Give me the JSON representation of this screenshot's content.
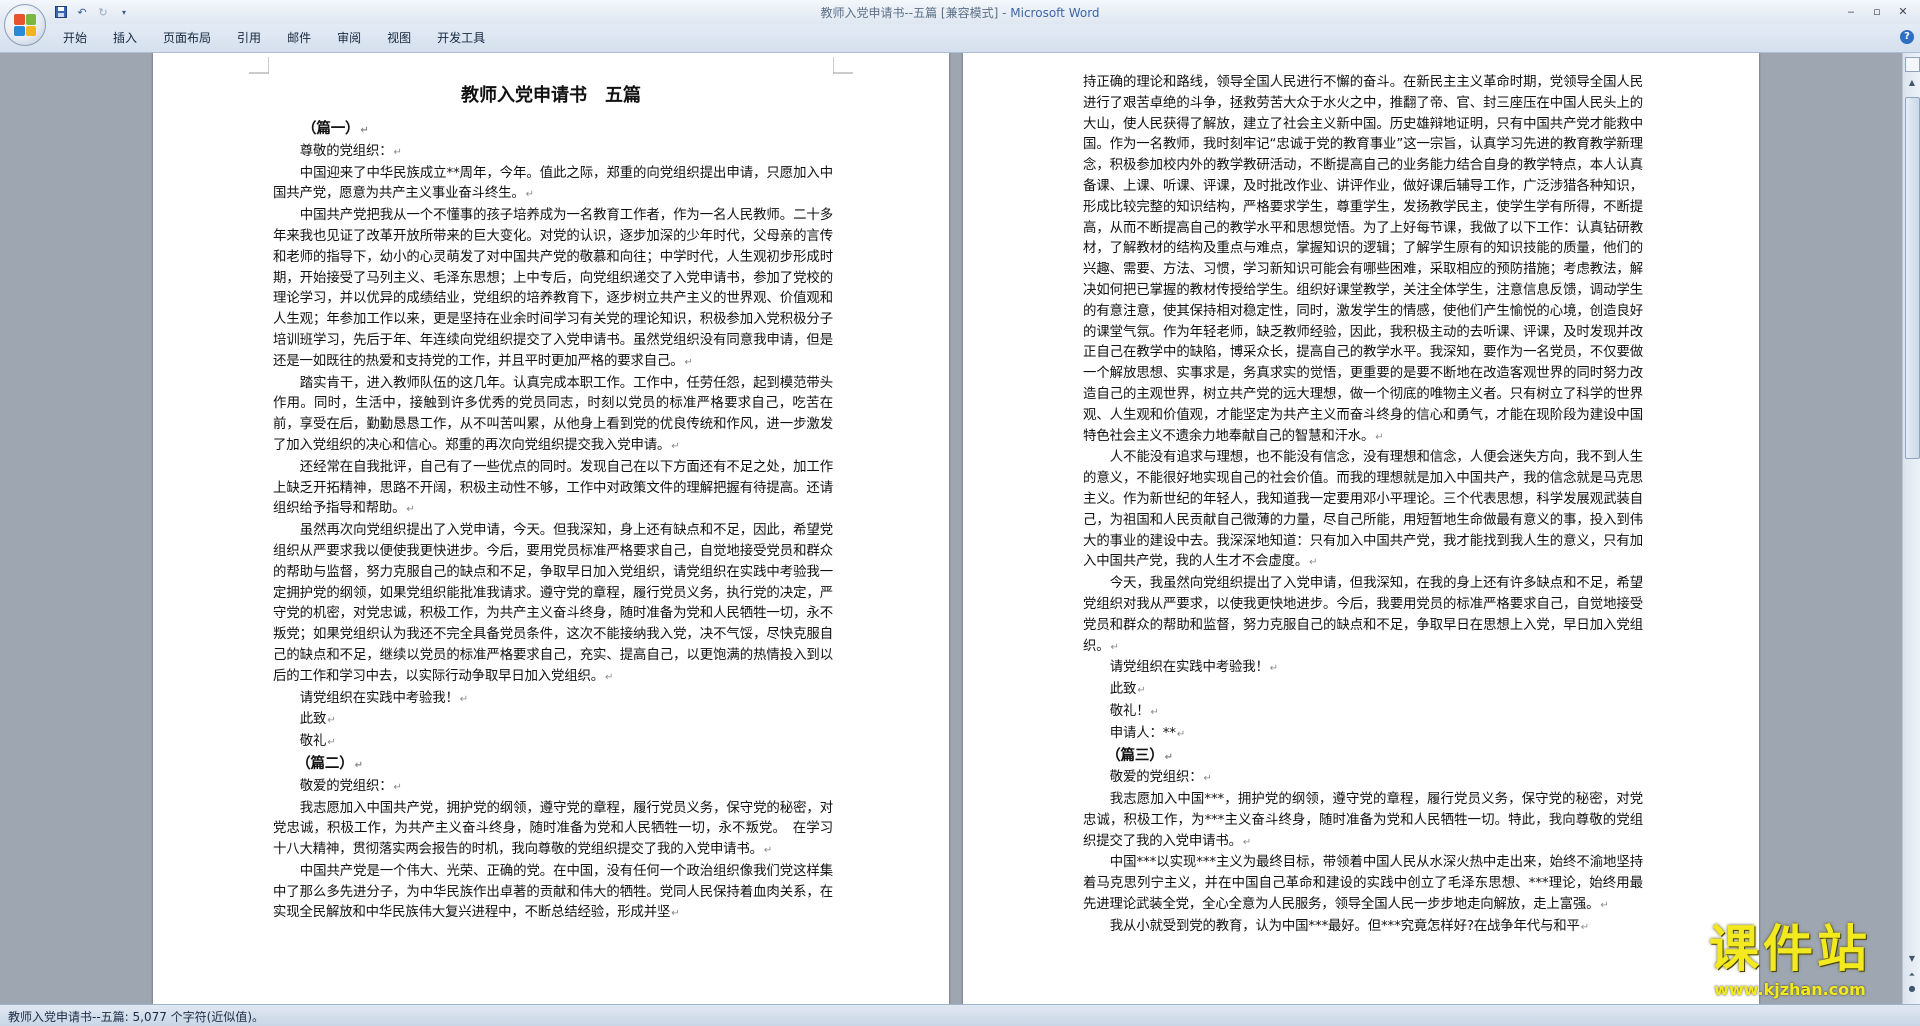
{
  "window": {
    "title_doc": "教师入党申请书--五篇 [兼容模式] - ",
    "title_app": "Microsoft Word"
  },
  "ribbon": {
    "tabs": [
      "开始",
      "插入",
      "页面布局",
      "引用",
      "邮件",
      "审阅",
      "视图",
      "开发工具"
    ]
  },
  "document": {
    "title": "教师入党申请书　五篇",
    "page1": [
      {
        "style": "heading",
        "text": "（篇一）"
      },
      {
        "style": "normal",
        "text": "尊敬的党组织："
      },
      {
        "style": "normal",
        "text": "中国迎来了中华民族成立**周年，今年。值此之际，郑重的向党组织提出申请，只愿加入中国共产党，愿意为共产主义事业奋斗终生。"
      },
      {
        "style": "normal",
        "text": "中国共产党把我从一个不懂事的孩子培养成为一名教育工作者，作为一名人民教师。二十多年来我也见证了改革开放所带来的巨大变化。对党的认识，逐步加深的少年时代，父母亲的言传和老师的指导下，幼小的心灵萌发了对中国共产党的敬慕和向往；中学时代，人生观初步形成时期，开始接受了马列主义、毛泽东思想；上中专后，向党组织递交了入党申请书，参加了党校的理论学习，并以优异的成绩结业，党组织的培养教育下，逐步树立共产主义的世界观、价值观和人生观；年参加工作以来，更是坚持在业余时间学习有关党的理论知识，积极参加入党积极分子培训班学习，先后于年、年连续向党组织提交了入党申请书。虽然党组织没有同意我申请，但是还是一如既往的热爱和支持党的工作，并且平时更加严格的要求自己。"
      },
      {
        "style": "normal",
        "text": "踏实肯干，进入教师队伍的这几年。认真完成本职工作。工作中，任劳任怨，起到模范带头作用。同时，生活中，接触到许多优秀的党员同志，时刻以党员的标准严格要求自己，吃苦在前，享受在后，勤勤恳恳工作，从不叫苦叫累，从他身上看到党的优良传统和作风，进一步激发了加入党组织的决心和信心。郑重的再次向党组织提交我入党申请。"
      },
      {
        "style": "normal",
        "text": "还经常在自我批评，自己有了一些优点的同时。发现自己在以下方面还有不足之处，加工作上缺乏开拓精神，思路不开阔，积极主动性不够，工作中对政策文件的理解把握有待提高。还请组织给予指导和帮助。"
      },
      {
        "style": "normal",
        "text": "虽然再次向党组织提出了入党申请，今天。但我深知，身上还有缺点和不足，因此，希望党组织从严要求我以便使我更快进步。今后，要用党员标准严格要求自己，自觉地接受党员和群众的帮助与监督，努力克服自己的缺点和不足，争取早日加入党组织，请党组织在实践中考验我一定拥护党的纲领，如果党组织能批准我请求。遵守党的章程，履行党员义务，执行党的决定，严守党的机密，对党忠诚，积极工作，为共产主义奋斗终身，随时准备为党和人民牺牲一切，永不叛党；如果党组织认为我还不完全具备党员条件，这次不能接纳我入党，决不气馁，尽快克服自己的缺点和不足，继续以党员的标准严格要求自己，充实、提高自己，以更饱满的热情投入到以后的工作和学习中去，以实际行动争取早日加入党组织。"
      },
      {
        "style": "normal",
        "text": "请党组织在实践中考验我！"
      },
      {
        "style": "normal",
        "text": "此致"
      },
      {
        "style": "normal",
        "text": "敬礼"
      },
      {
        "style": "sec",
        "text": "（篇二）"
      },
      {
        "style": "normal",
        "text": "敬爱的党组织："
      },
      {
        "style": "normal",
        "text": "我志愿加入中国共产党，拥护党的纲领，遵守党的章程，履行党员义务，保守党的秘密，对党忠诚，积极工作，为共产主义奋斗终身，随时准备为党和人民牺牲一切，永不叛党。　在学习十八大精神，贯彻落实两会报告的时机，我向尊敬的党组织提交了我的入党申请书。"
      },
      {
        "style": "normal",
        "text": "中国共产党是一个伟大、光荣、正确的党。在中国，没有任何一个政治组织像我们党这样集中了那么多先进分子，为中华民族作出卓著的贡献和伟大的牺牲。党同人民保持着血肉关系，在实现全民解放和中华民族伟大复兴进程中，不断总结经验，形成并坚"
      }
    ],
    "page2": [
      {
        "style": "noindent",
        "text": "持正确的理论和路线，领导全国人民进行不懈的奋斗。在新民主主义革命时期，党领导全国人民进行了艰苦卓绝的斗争，拯救劳苦大众于水火之中，推翻了帝、官、封三座压在中国人民头上的大山，使人民获得了解放，建立了社会主义新中国。历史雄辩地证明，只有中国共产党才能救中国。作为一名教师，我时刻牢记“忠诚于党的教育事业”这一宗旨，认真学习先进的教育教学新理念，积极参加校内外的教学教研活动，不断提高自己的业务能力结合自身的教学特点，本人认真备课、上课、听课、评课，及时批改作业、讲评作业，做好课后辅导工作，广泛涉猎各种知识，形成比较完整的知识结构，严格要求学生，尊重学生，发扬教学民主，使学生学有所得，不断提高，从而不断提高自己的教学水平和思想觉悟。为了上好每节课，我做了以下工作：认真钻研教材，了解教材的结构及重点与难点，掌握知识的逻辑；了解学生原有的知识技能的质量，他们的兴趣、需要、方法、习惯，学习新知识可能会有哪些困难，采取相应的预防措施；考虑教法，解决如何把已掌握的教材传授给学生。组织好课堂教学，关注全体学生，注意信息反馈，调动学生的有意注意，使其保持相对稳定性，同时，激发学生的情感，使他们产生愉悦的心境，创造良好的课堂气氛。作为年轻老师，缺乏教师经验，因此，我积极主动的去听课、评课，及时发现并改正自己在教学中的缺陷，博采众长，提高自己的教学水平。我深知，要作为一名党员，不仅要做一个解放思想、实事求是，务真求实的觉悟，更重要的是要不断地在改造客观世界的同时努力改造自己的主观世界，树立共产党的远大理想，做一个彻底的唯物主义者。只有树立了科学的世界观、人生观和价值观，才能坚定为共产主义而奋斗终身的信心和勇气，才能在现阶段为建设中国特色社会主义不遗余力地奉献自己的智慧和汗水。"
      },
      {
        "style": "normal",
        "text": "人不能没有追求与理想，也不能没有信念，没有理想和信念，人便会迷失方向，我不到人生的意义，不能很好地实现自己的社会价值。而我的理想就是加入中国共产，我的信念就是马克思主义。作为新世纪的年轻人，我知道我一定要用邓小平理论。三个代表思想，科学发展观武装自己，为祖国和人民贡献自己微薄的力量，尽自己所能，用短暂地生命做最有意义的事，投入到伟大的事业的建设中去。我深深地知道：只有加入中国共产党，我才能找到我人生的意义，只有加入中国共产党，我的人生才不会虚度。"
      },
      {
        "style": "normal",
        "text": "今天，我虽然向党组织提出了入党申请，但我深知，在我的身上还有许多缺点和不足，希望党组织对我从严要求，以使我更快地进步。今后，我要用党员的标准严格要求自己，自觉地接受党员和群众的帮助和监督，努力克服自己的缺点和不足，争取早日在思想上入党，早日加入党组织。"
      },
      {
        "style": "normal",
        "text": "请党组织在实践中考验我！"
      },
      {
        "style": "normal",
        "text": "此致"
      },
      {
        "style": "normal",
        "text": "敬礼！"
      },
      {
        "style": "normal",
        "text": "申请人：**"
      },
      {
        "style": "sec",
        "text": "（篇三）"
      },
      {
        "style": "normal",
        "text": "敬爱的党组织："
      },
      {
        "style": "normal",
        "text": "我志愿加入中国***，拥护党的纲领，遵守党的章程，履行党员义务，保守党的秘密，对党忠诚，积极工作，为***主义奋斗终身，随时准备为党和人民牺牲一切。特此，我向尊敬的党组织提交了我的入党申请书。"
      },
      {
        "style": "normal",
        "text": "中国***以实现***主义为最终目标，带领着中国人民从水深火热中走出来，始终不渝地坚持着马克思列宁主义，并在中国自己革命和建设的实践中创立了毛泽东思想、***理论，始终用最先进理论武装全党，全心全意为人民服务，领导全国人民一步步地走向解放，走上富强。"
      },
      {
        "style": "normal",
        "text": "我从小就受到党的教育，认为中国***最好。但***究竟怎样好?在战争年代与和平"
      }
    ]
  },
  "status": {
    "text": "教师入党申请书--五篇: 5,077 个字符(近似值)。"
  },
  "watermark": {
    "main": "课件站",
    "url": "www.kjzhan.com"
  },
  "colors": {
    "ribbon": "#dae5f2",
    "workspace": "#9da6b1",
    "watermark": "#f2ea1e"
  }
}
